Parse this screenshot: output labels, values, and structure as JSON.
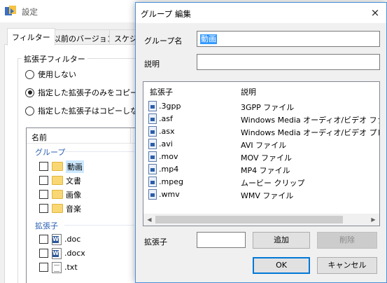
{
  "background_window": {
    "title": "設定",
    "tabs": [
      "フィルター",
      "以前のバージョン",
      "スケジ"
    ],
    "filter_group_label": "拡張子フィルター",
    "radio_options": [
      {
        "label": "使用しない",
        "checked": false
      },
      {
        "label": "指定した拡張子のみをコピー",
        "checked": true
      },
      {
        "label": "指定した拡張子はコピーしない",
        "checked": false
      }
    ],
    "list": {
      "column_name": "名前",
      "groups_header": "グループ",
      "groups": [
        "動画",
        "文書",
        "画像",
        "音楽"
      ],
      "extensions_header": "拡張子",
      "extensions": [
        ".doc",
        ".docx",
        ".txt"
      ]
    }
  },
  "dialog": {
    "title": "グループ 編集",
    "close_icon": "×",
    "group_name_label": "グループ名",
    "group_name_value": "動画",
    "description_label": "説明",
    "description_value": "",
    "list_header_ext": "拡張子",
    "list_header_desc": "説明",
    "rows": [
      {
        "ext": ".3gpp",
        "desc": "3GPP ファイル"
      },
      {
        "ext": ".asf",
        "desc": "Windows Media オーディオ/ビデオ ファイ"
      },
      {
        "ext": ".asx",
        "desc": "Windows Media オーディオ/ビデオ プレー"
      },
      {
        "ext": ".avi",
        "desc": "AVI ファイル"
      },
      {
        "ext": ".mov",
        "desc": "MOV ファイル"
      },
      {
        "ext": ".mp4",
        "desc": "MP4 ファイル"
      },
      {
        "ext": ".mpeg",
        "desc": "ムービー クリップ"
      },
      {
        "ext": ".wmv",
        "desc": "WMV ファイル"
      }
    ],
    "ext_input_label": "拡張子",
    "ext_input_value": "",
    "add_button": "追加",
    "delete_button": "削除",
    "ok_button": "OK",
    "cancel_button": "キャンセル"
  }
}
